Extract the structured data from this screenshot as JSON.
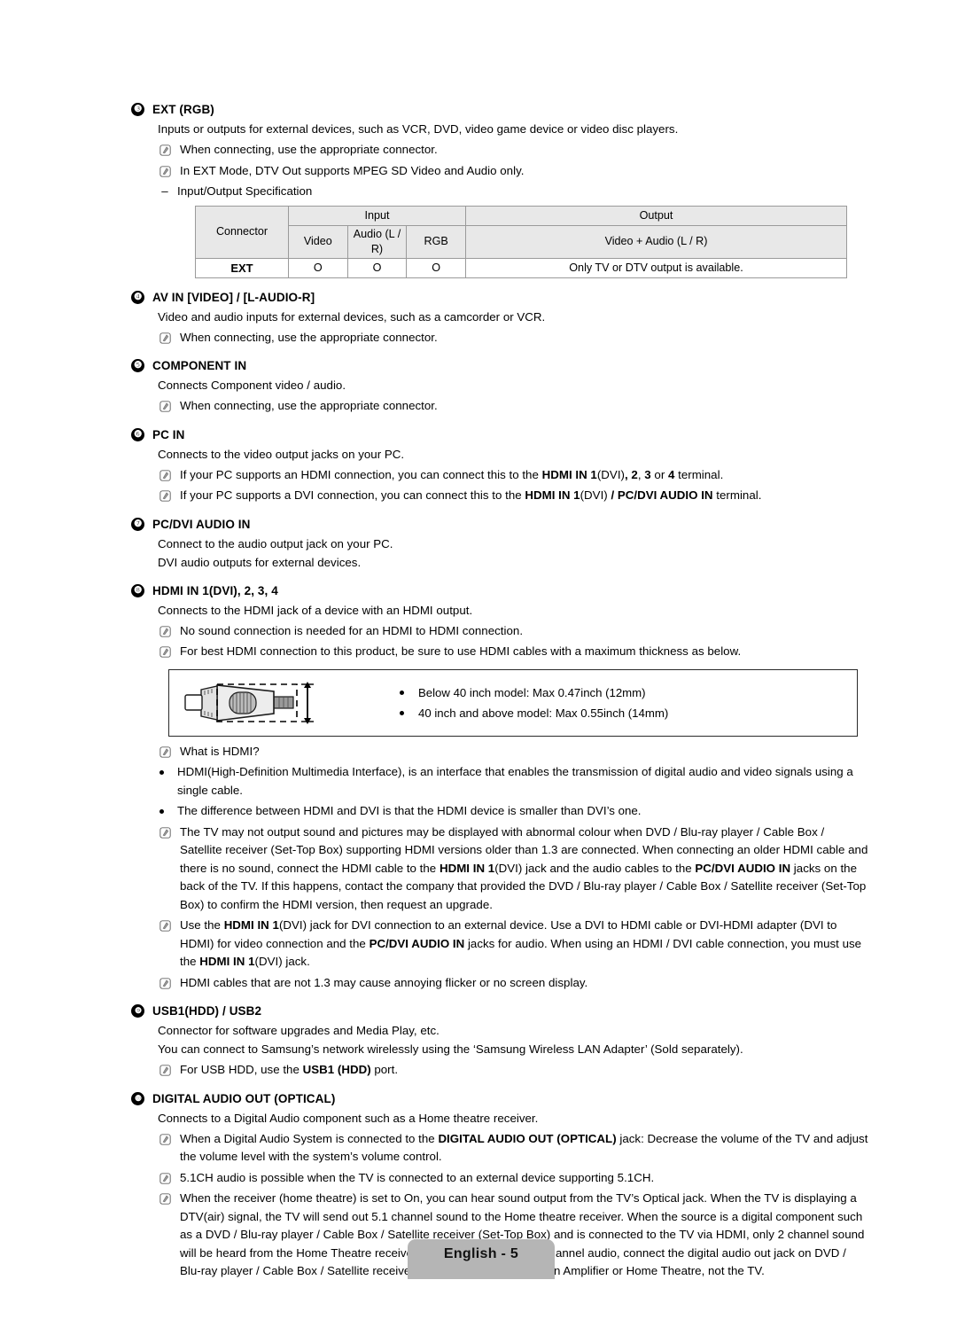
{
  "page": {
    "footer_label": "English - 5",
    "note_icon_name": "note-icon",
    "dash_mark": "–"
  },
  "sections": [
    {
      "number": "❸",
      "title": "EXT (RGB)",
      "intro": "Inputs or outputs for external devices, such as VCR, DVD, video game device or video disc players.",
      "notes": [
        "When connecting, use the appropriate connector.",
        "In EXT Mode, DTV Out supports MPEG SD Video and Audio only."
      ],
      "dash_item": "Input/Output Specification"
    },
    {
      "number": "❹",
      "title": "AV IN [VIDEO] / [L-AUDIO-R]",
      "intro": "Video and audio inputs for external devices, such as a camcorder or VCR.",
      "notes": [
        "When connecting, use the appropriate connector."
      ]
    },
    {
      "number": "❺",
      "title": "COMPONENT IN",
      "intro": "Connects Component video / audio.",
      "notes": [
        "When connecting, use the appropriate connector."
      ]
    },
    {
      "number": "❻",
      "title": "PC IN",
      "intro": "Connects to the video output jacks on your PC.",
      "notes": [
        "If your PC supports an HDMI connection, you can connect this to the HDMI IN 1(DVI), 2, 3 or 4 terminal.",
        "If your PC supports a DVI connection, you can connect this to the HDMI IN 1(DVI) / PC/DVI AUDIO IN terminal."
      ]
    },
    {
      "number": "❼",
      "title": "PC/DVI AUDIO IN",
      "intro": "Connect to the audio output jack on your PC.",
      "intro2": "DVI audio outputs for external devices."
    },
    {
      "number": "❽",
      "title": "HDMI IN 1(DVI), 2, 3, 4",
      "intro": "Connects to the HDMI jack of a device with an HDMI output.",
      "notes": [
        "No sound connection is needed for an HDMI to HDMI connection.",
        "For best HDMI connection to this product, be sure to use HDMI cables with a maximum thickness as below."
      ]
    },
    {
      "number": "❾",
      "title": "USB1(HDD) / USB2",
      "intro": "Connector for software upgrades and Media Play, etc.",
      "intro2": "You can connect to Samsung’s network wirelessly using the ‘Samsung Wireless LAN Adapter’ (Sold separately).",
      "notes": [
        "For USB HDD, use the USB1 (HDD) port."
      ]
    },
    {
      "number": "❿",
      "title": "DIGITAL AUDIO OUT (OPTICAL)",
      "intro": "Connects to a Digital Audio component such as a Home theatre receiver.",
      "notes": [
        "When a Digital Audio System is connected to the DIGITAL AUDIO OUT (OPTICAL) jack: Decrease the volume of the TV and adjust the volume level with the system’s volume control.",
        "5.1CH audio is possible when the TV is connected to an external device supporting 5.1CH.",
        "When the receiver (home theatre) is set to On, you can hear sound output from the TV’s Optical jack. When the TV is displaying a DTV(air) signal, the TV will send out 5.1 channel sound to the Home theatre receiver. When the source is a digital component such as a DVD / Blu-ray player / Cable Box / Satellite receiver (Set-Top Box) and is connected to the TV via HDMI, only 2 channel sound will be heard from the Home Theatre receiver. If you want to hear 5.1 channel audio, connect the digital audio out jack on DVD / Blu-ray player / Cable Box / Satellite receiver (Set-Top Box) directly to an Amplifier or Home Theatre, not the TV."
      ]
    }
  ],
  "spec_table": {
    "group_headers": [
      "Connector",
      "Input",
      "Output"
    ],
    "sub_headers": [
      "Video",
      "Audio (L / R)",
      "RGB",
      "Video + Audio (L / R)"
    ],
    "rows": [
      {
        "connector": "EXT",
        "video": "O",
        "audio": "O",
        "rgb": "O",
        "output": "Only TV or DTV output is available."
      }
    ]
  },
  "hdmi_figure": {
    "items": [
      "Below 40 inch model: Max 0.47inch (12mm)",
      "40 inch and above model: Max 0.55inch (14mm)"
    ]
  },
  "hdmi_info": {
    "question": "What is HDMI?",
    "bullets": [
      "HDMI(High-Definition Multimedia Interface), is an interface that enables the transmission of digital audio and video signals using a single cable.",
      "The difference between HDMI and DVI is that the HDMI device is smaller than DVI’s one."
    ],
    "notes": [
      "The TV may not output sound and pictures may be displayed with abnormal colour when DVD / Blu-ray player / Cable Box / Satellite receiver (Set-Top Box) supporting HDMI versions older than 1.3 are connected. When connecting an older HDMI cable and there is no sound, connect the HDMI cable to the HDMI IN 1(DVI) jack and the audio cables to the PC/DVI AUDIO IN jacks on the back of the TV. If this happens, contact the company that provided the DVD / Blu-ray player / Cable Box / Satellite receiver (Set-Top Box) to confirm the HDMI version, then request an upgrade.",
      "Use the HDMI IN 1(DVI) jack for DVI connection to an external device. Use a DVI to HDMI cable or DVI-HDMI adapter (DVI to HDMI) for video connection and the PC/DVI AUDIO IN jacks for audio. When using an HDMI / DVI cable connection, you must use the HDMI IN 1(DVI) jack.",
      "HDMI cables that are not 1.3 may cause annoying flicker or no screen display."
    ]
  },
  "colors": {
    "table_header_bg": "#e8e8e8",
    "table_border": "#9a9a9a",
    "footer_bg": "#b5b5b5",
    "text": "#000000"
  }
}
